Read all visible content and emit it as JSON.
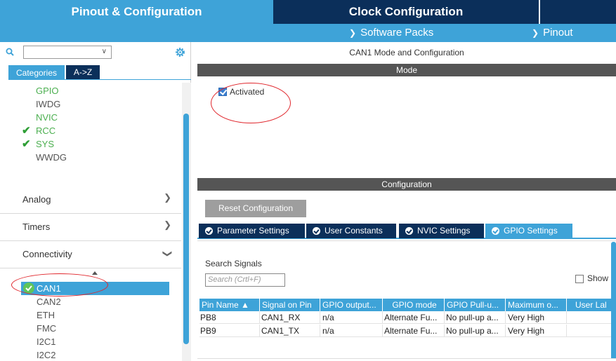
{
  "header": {
    "tab_pinout": "Pinout & Configuration",
    "tab_clock": "Clock Configuration",
    "software_packs": "Software Packs",
    "pinout": "Pinout"
  },
  "left": {
    "search_placeholder": "",
    "categories_tab": "Categories",
    "az_tab": "A->Z",
    "system_items": [
      {
        "label": "GPIO",
        "state": "green",
        "checked": false
      },
      {
        "label": "IWDG",
        "state": "gray",
        "checked": false
      },
      {
        "label": "NVIC",
        "state": "green",
        "checked": false
      },
      {
        "label": "RCC",
        "state": "green",
        "checked": true
      },
      {
        "label": "SYS",
        "state": "green",
        "checked": true
      },
      {
        "label": "WWDG",
        "state": "gray",
        "checked": false
      }
    ],
    "categories": [
      {
        "label": "Analog",
        "expanded": false
      },
      {
        "label": "Timers",
        "expanded": false
      },
      {
        "label": "Connectivity",
        "expanded": true
      }
    ],
    "connectivity_items": [
      {
        "label": "CAN1",
        "selected": true
      },
      {
        "label": "CAN2",
        "selected": false
      },
      {
        "label": "ETH",
        "selected": false
      },
      {
        "label": "FMC",
        "selected": false
      },
      {
        "label": "I2C1",
        "selected": false
      },
      {
        "label": "I2C2",
        "selected": false
      }
    ]
  },
  "right": {
    "title": "CAN1 Mode and Configuration",
    "mode_header": "Mode",
    "activated_label": "Activated",
    "activated": true,
    "configuration_header": "Configuration",
    "reset_button": "Reset Configuration",
    "tabs": [
      {
        "label": "Parameter Settings",
        "active": false
      },
      {
        "label": "User Constants",
        "active": false
      },
      {
        "label": "NVIC Settings",
        "active": false
      },
      {
        "label": "GPIO Settings",
        "active": true
      }
    ],
    "search_signals_label": "Search Signals",
    "search_signals_placeholder": "Search (Crtl+F)",
    "show_label": "Show",
    "table": {
      "columns": [
        "Pin Name",
        "Signal on Pin",
        "GPIO output...",
        "GPIO mode",
        "GPIO Pull-u...",
        "Maximum o...",
        "User Lal"
      ],
      "rows": [
        [
          "PB8",
          "CAN1_RX",
          "n/a",
          "Alternate Fu...",
          "No pull-up a...",
          "Very High",
          ""
        ],
        [
          "PB9",
          "CAN1_TX",
          "n/a",
          "Alternate Fu...",
          "No pull-up a...",
          "Very High",
          ""
        ]
      ]
    }
  },
  "colors": {
    "accent_blue": "#3ea3d8",
    "dark_navy": "#0b2f5a",
    "section_gray": "#555555",
    "green_enabled": "#4caf50",
    "annotation_red": "#e0262c"
  }
}
